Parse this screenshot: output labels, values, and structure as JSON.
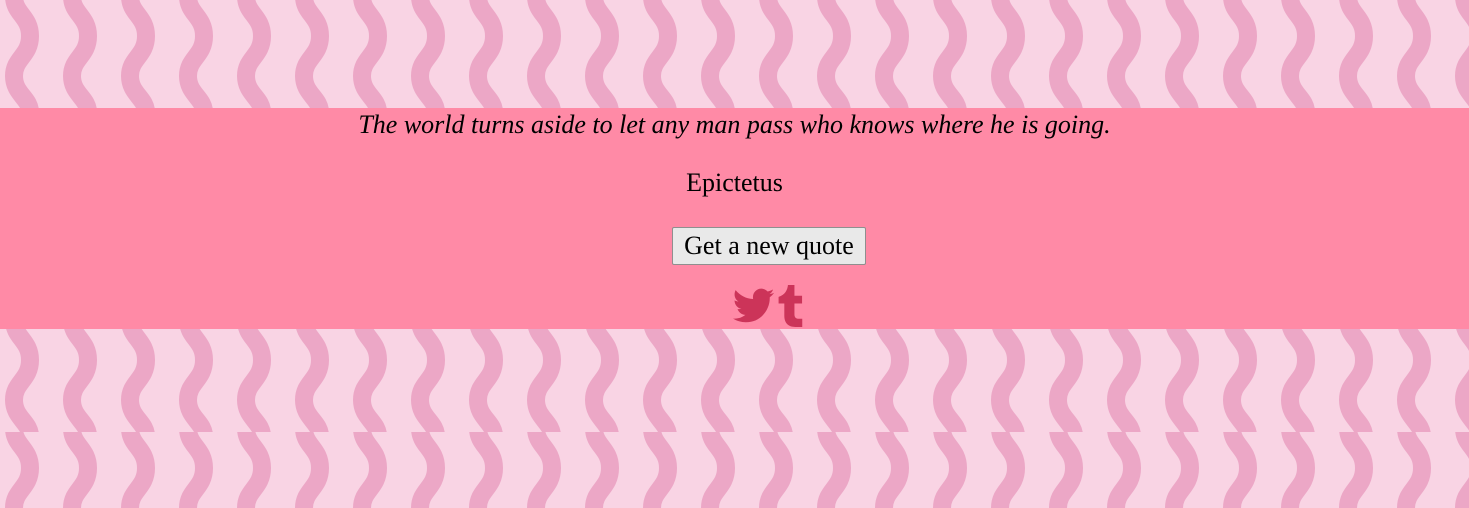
{
  "quote": {
    "text": "The world turns aside to let any man pass who knows where he is going.",
    "author": "Epictetus"
  },
  "actions": {
    "new_quote_label": "Get a new quote"
  },
  "share": {
    "twitter_icon": "twitter-bird-icon",
    "tumblr_icon": "tumblr-t-icon"
  },
  "colors": {
    "background_light": "#f9d4e4",
    "background_wave": "#eca7c6",
    "band": "#ff8aa6",
    "icon": "#cc3459",
    "button_bg": "#e9e9e9"
  }
}
